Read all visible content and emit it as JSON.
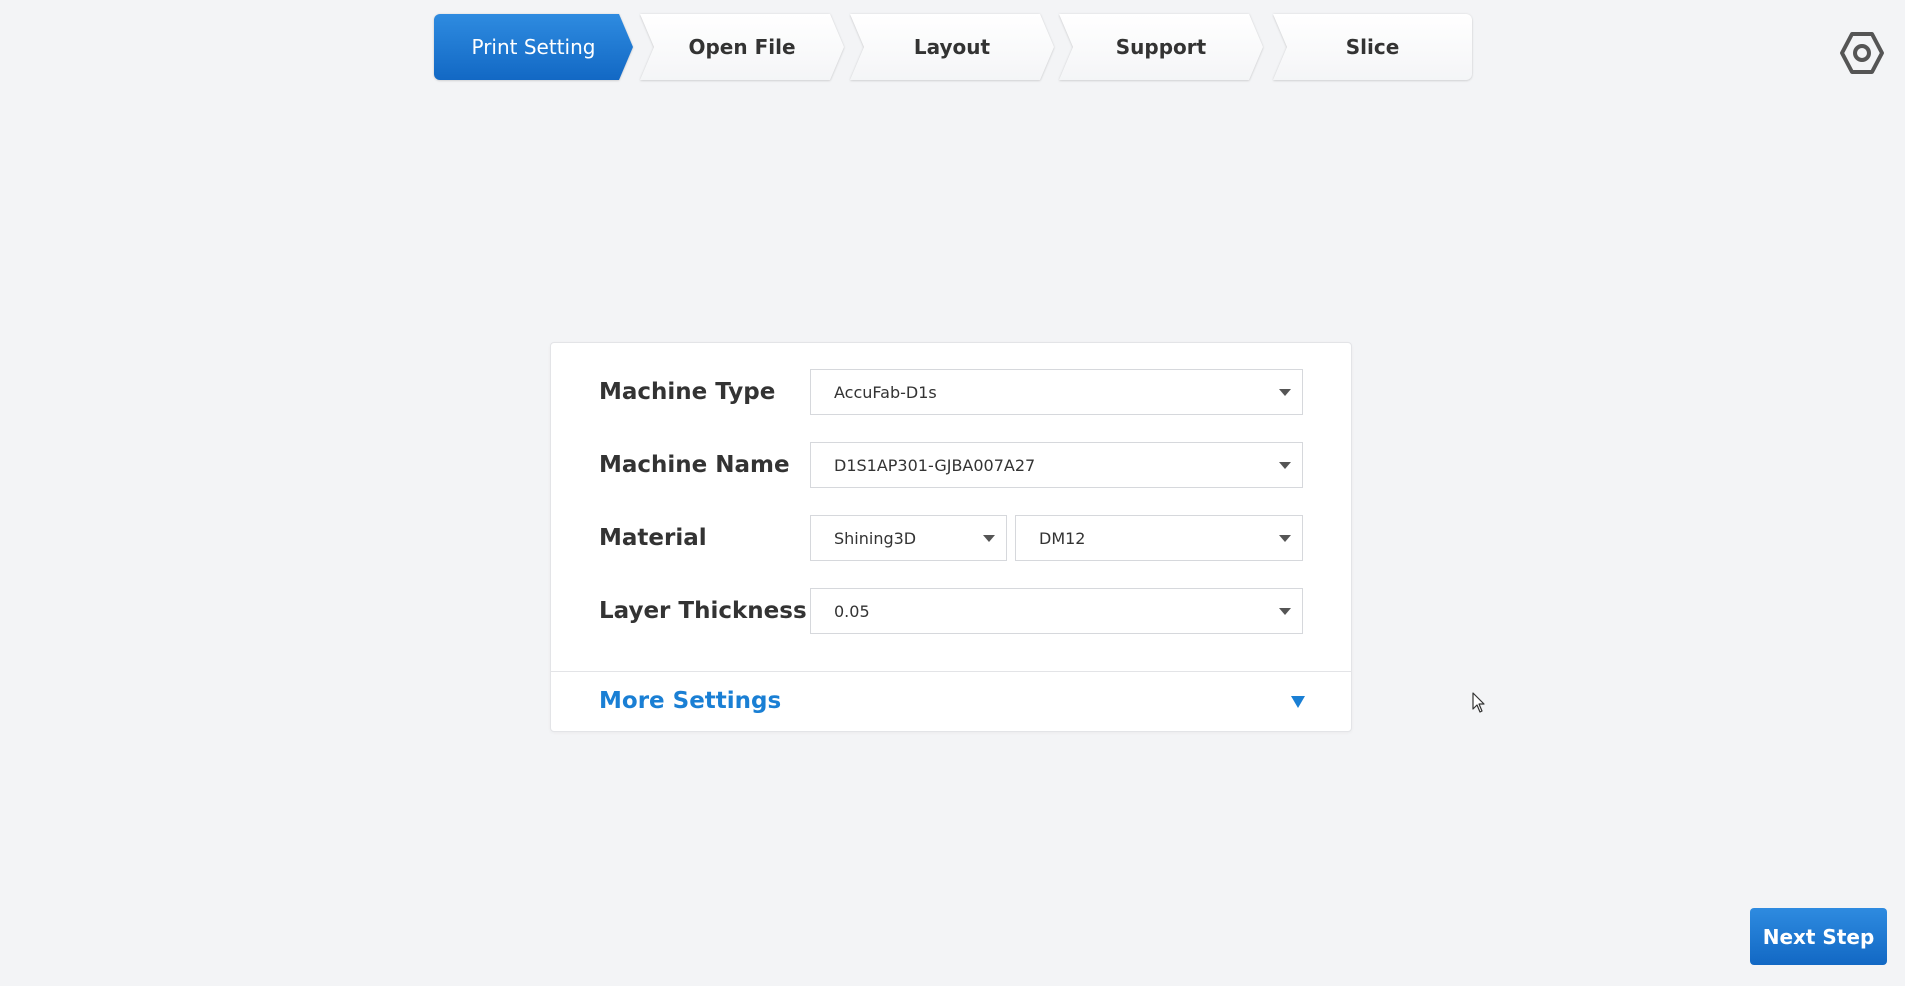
{
  "stepper": {
    "steps": [
      {
        "label": "Print Setting",
        "active": true
      },
      {
        "label": "Open File",
        "active": false
      },
      {
        "label": "Layout",
        "active": false
      },
      {
        "label": "Support",
        "active": false
      },
      {
        "label": "Slice",
        "active": false
      }
    ]
  },
  "settings_icon": "gear-icon",
  "form": {
    "machine_type": {
      "label": "Machine Type",
      "value": "AccuFab-D1s"
    },
    "machine_name": {
      "label": "Machine Name",
      "value": "D1S1AP301-GJBA007A27"
    },
    "material": {
      "label": "Material",
      "brand": "Shining3D",
      "resin": "DM12"
    },
    "layer_thickness": {
      "label": "Layer Thickness",
      "value": "0.05"
    }
  },
  "more_settings": {
    "label": "More Settings",
    "expanded": false
  },
  "next_step": {
    "label": "Next Step"
  },
  "colors": {
    "accent": "#1a7fd4",
    "background": "#f3f4f6",
    "panel": "#ffffff"
  }
}
